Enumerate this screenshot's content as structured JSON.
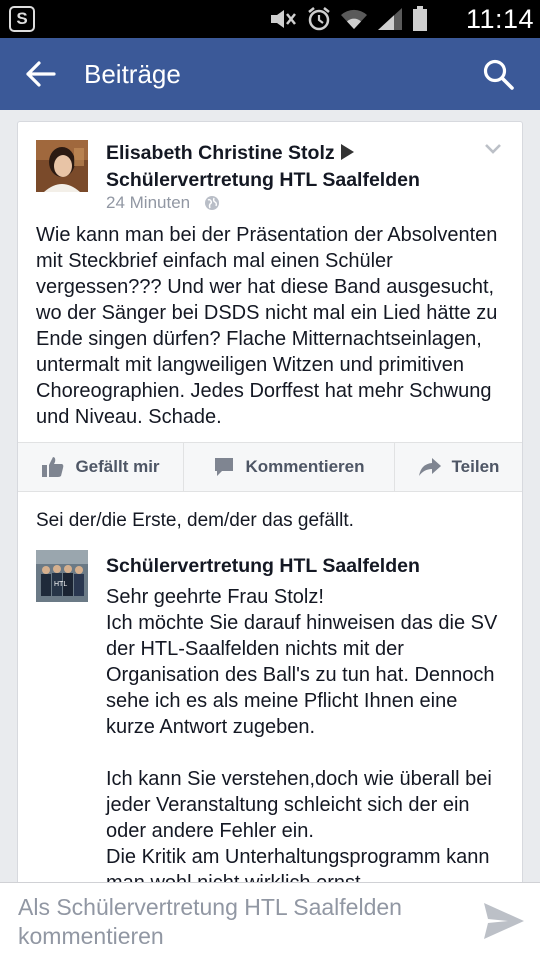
{
  "status_bar": {
    "app_badge": "S",
    "time": "11:14",
    "icons": [
      "mute-icon",
      "alarm-icon",
      "wifi-icon",
      "signal-icon",
      "battery-icon"
    ]
  },
  "app_bar": {
    "title": "Beiträge",
    "background": "#3b5998"
  },
  "post": {
    "author": "Elisabeth Christine Stolz",
    "target": "Schülervertretung HTL Saalfelden",
    "time": "24 Minuten",
    "privacy_icon": "globe-icon",
    "text": "Wie kann man bei der Präsentation der Absolventen mit Steckbrief einfach mal einen Schüler vergessen??? Und wer hat diese Band ausgesucht, wo der Sänger bei DSDS nicht mal ein Lied hätte zu Ende singen dürfen? Flache Mitternachtseinlagen, untermalt mit langweiligen Witzen und primitiven Choreographien. Jedes Dorffest hat mehr Schwung und Niveau. Schade."
  },
  "actions": {
    "like": "Gefällt mir",
    "comment": "Kommentieren",
    "share": "Teilen"
  },
  "likes_line": "Sei der/die Erste, dem/der das gefällt.",
  "comment": {
    "author": "Schülervertretung HTL Saalfelden",
    "avatar_label": "HTL",
    "text": "Sehr geehrte Frau Stolz!\nIch möchte Sie darauf hinweisen das die SV der HTL-Saalfelden nichts mit der Organisation des Ball's zu tun hat. Dennoch sehe ich es als meine Pflicht Ihnen eine kurze Antwort zugeben.\n\nIch kann Sie verstehen,doch wie überall bei jeder Veranstaltung schleicht sich der ein oder andere Fehler ein.\nDie  Kritik am Unterhaltungsprogramm kann man wohl nicht wirklich ernst"
  },
  "composer": {
    "placeholder": "Als Schülervertretung HTL Saalfelden kommentieren",
    "value": ""
  }
}
